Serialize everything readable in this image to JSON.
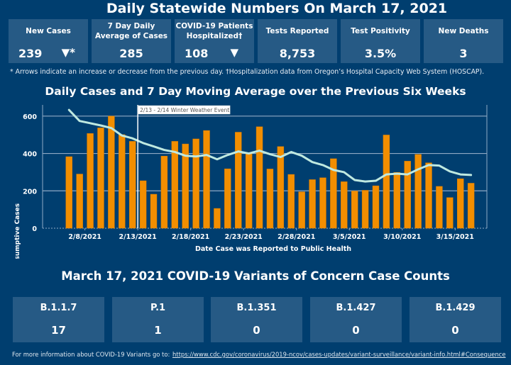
{
  "header": {
    "title": "Daily Statewide Numbers On March 17, 2021"
  },
  "kpis": [
    {
      "label": "New Cases",
      "value": "239",
      "indicator": "▼*",
      "indicator_icon": "down-triangle-icon"
    },
    {
      "label": "7 Day Daily Average of Cases",
      "value": "285"
    },
    {
      "label": "COVID-19 Patients Hospitalized†",
      "value": "108",
      "indicator": "▼",
      "indicator_icon": "down-triangle-icon"
    },
    {
      "label": "Tests Reported",
      "value": "8,753"
    },
    {
      "label": "Test Positivity",
      "value": "3.5%"
    },
    {
      "label": "New Deaths",
      "value": "3"
    }
  ],
  "footnote": "* Arrows indicate an increase or decrease from the previous day. †Hospitalization data from Oregon’s Hospital Capacity Web System (HOSCAP).",
  "colors": {
    "background": "#003e6f",
    "tile": "#265a85",
    "bar": "#f28e00",
    "line": "#bfe9e0",
    "grid": "#8fa9c4"
  },
  "chart_data": {
    "type": "bar",
    "title": "Daily Cases and 7 Day Moving Average over the Previous Six Weeks",
    "xlabel": "Date Case was Reported to Public Health",
    "ylabel": "Confirmed and Presumptive Cases",
    "ylim": [
      0,
      660
    ],
    "yticks": [
      0,
      200,
      400,
      600
    ],
    "grid": true,
    "x_tick_labels": [
      "2/8/2021",
      "2/13/2021",
      "2/18/2021",
      "2/23/2021",
      "2/28/2021",
      "3/5/2021",
      "3/10/2021",
      "3/15/2021"
    ],
    "x_range": [
      "2/4/2021",
      "3/18/2021"
    ],
    "annotation": {
      "date": "2/13",
      "label": "2/13 - 2/14 Winter Weather Event"
    },
    "categories": [
      "2/6",
      "2/7",
      "2/8",
      "2/9",
      "2/10",
      "2/11",
      "2/12",
      "2/13",
      "2/14",
      "2/15",
      "2/16",
      "2/17",
      "2/18",
      "2/19",
      "2/20",
      "2/21",
      "2/22",
      "2/23",
      "2/24",
      "2/25",
      "2/26",
      "2/27",
      "2/28",
      "3/1",
      "3/2",
      "3/3",
      "3/4",
      "3/5",
      "3/6",
      "3/7",
      "3/8",
      "3/9",
      "3/10",
      "3/11",
      "3/12",
      "3/13",
      "3/14",
      "3/15",
      "3/16"
    ],
    "series": [
      {
        "name": "Daily Cases",
        "type": "bar",
        "values": [
          383,
          290,
          507,
          537,
          600,
          501,
          465,
          254,
          182,
          386,
          465,
          451,
          478,
          523,
          106,
          318,
          514,
          399,
          543,
          317,
          437,
          288,
          195,
          260,
          270,
          372,
          249,
          199,
          203,
          227,
          499,
          299,
          359,
          395,
          350,
          224,
          164,
          265,
          241
        ]
      },
      {
        "name": "7 Day Moving Average",
        "type": "line",
        "values": [
          633,
          574,
          562,
          550,
          536,
          496,
          481,
          456,
          438,
          419,
          408,
          388,
          384,
          392,
          369,
          392,
          411,
          400,
          415,
          396,
          381,
          408,
          388,
          354,
          338,
          312,
          300,
          258,
          250,
          254,
          288,
          292,
          288,
          315,
          338,
          335,
          304,
          288,
          285
        ]
      }
    ]
  },
  "variants": {
    "title": "March 17, 2021 COVID-19 Variants of Concern Case Counts",
    "items": [
      {
        "name": "B.1.1.7",
        "count": "17"
      },
      {
        "name": "P.1",
        "count": "1"
      },
      {
        "name": "B.1.351",
        "count": "0"
      },
      {
        "name": "B.1.427",
        "count": "0"
      },
      {
        "name": "B.1.429",
        "count": "0"
      }
    ],
    "more_info_text": "For more information about COVID-19 Variants go to:",
    "link_text": "https://www.cdc.gov/coronavirus/2019-ncov/cases-updates/variant-surveillance/variant-info.html#Consequence"
  }
}
